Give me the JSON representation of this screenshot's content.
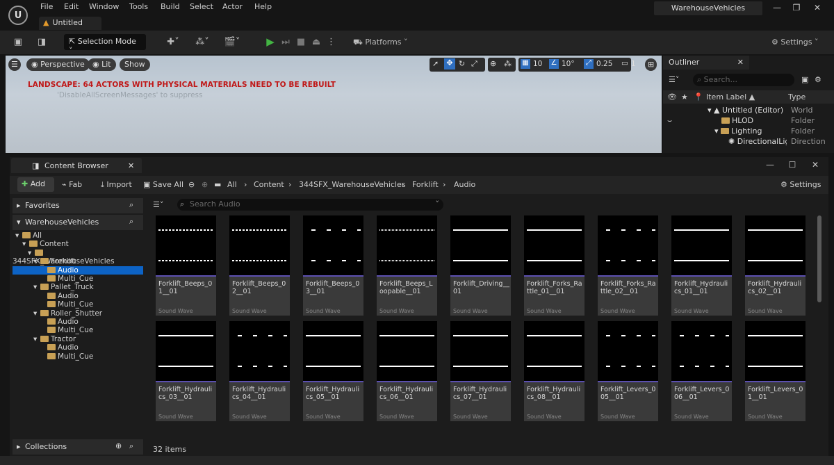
{
  "menubar": {
    "logo": "U",
    "items": [
      "File",
      "Edit",
      "Window",
      "Tools",
      "Build",
      "Select",
      "Actor",
      "Help"
    ],
    "level_tab": "Untitled",
    "project": "WarehouseVehicles"
  },
  "toolbar": {
    "selection_mode": "Selection Mode",
    "platforms": "Platforms",
    "settings": "Settings"
  },
  "viewport": {
    "perspective": "Perspective",
    "lit": "Lit",
    "show": "Show",
    "warning": "LANDSCAPE: 64 ACTORS WITH PHYSICAL MATERIALS NEED TO BE REBUILT",
    "warning_sub": "'DisableAllScreenMessages' to suppress",
    "grid": "10",
    "angle": "10°",
    "scale": "0.25",
    "camera": "1"
  },
  "outliner": {
    "title": "Outliner",
    "search_placeholder": "Search...",
    "col_label": "Item Label ▲",
    "col_type": "Type",
    "rows": [
      {
        "label": "Untitled (Editor)",
        "type": "World"
      },
      {
        "label": "HLOD",
        "type": "Folder"
      },
      {
        "label": "Lighting",
        "type": "Folder"
      },
      {
        "label": "DirectionalLigl",
        "type": "Direction"
      }
    ]
  },
  "content_browser": {
    "title": "Content Browser",
    "add": "Add",
    "fab": "Fab",
    "import": "Import",
    "save_all": "Save All",
    "settings": "Settings",
    "breadcrumb": [
      "All",
      "Content",
      "344SFX_WarehouseVehicles",
      "Forklift",
      "Audio"
    ],
    "favorites": "Favorites",
    "project": "WarehouseVehicles",
    "collections": "Collections",
    "search_placeholder": "Search Audio",
    "item_count": "32 items",
    "tree": [
      "All",
      "Content",
      "344SFX_WarehouseVehicles",
      "Forklift",
      "Audio",
      "Multi_Cue",
      "Pallet_Truck",
      "Audio",
      "Multi_Cue",
      "Roller_Shutter",
      "Audio",
      "Multi_Cue",
      "Tractor",
      "Audio",
      "Multi_Cue"
    ],
    "assets": [
      {
        "name": "Forklift_Beeps_01__01",
        "type": "Sound Wave"
      },
      {
        "name": "Forklift_Beeps_02__01",
        "type": "Sound Wave"
      },
      {
        "name": "Forklift_Beeps_03__01",
        "type": "Sound Wave"
      },
      {
        "name": "Forklift_Beeps_Loopable__01",
        "type": "Sound Wave"
      },
      {
        "name": "Forklift_Driving__01",
        "type": "Sound Wave"
      },
      {
        "name": "Forklift_Forks_Rattle_01__01",
        "type": "Sound Wave"
      },
      {
        "name": "Forklift_Forks_Rattle_02__01",
        "type": "Sound Wave"
      },
      {
        "name": "Forklift_Hydraulics_01__01",
        "type": "Sound Wave"
      },
      {
        "name": "Forklift_Hydraulics_02__01",
        "type": "Sound Wave"
      },
      {
        "name": "Forklift_Hydraulics_03__01",
        "type": "Sound Wave"
      },
      {
        "name": "Forklift_Hydraulics_04__01",
        "type": "Sound Wave"
      },
      {
        "name": "Forklift_Hydraulics_05__01",
        "type": "Sound Wave"
      },
      {
        "name": "Forklift_Hydraulics_06__01",
        "type": "Sound Wave"
      },
      {
        "name": "Forklift_Hydraulics_07__01",
        "type": "Sound Wave"
      },
      {
        "name": "Forklift_Hydraulics_08__01",
        "type": "Sound Wave"
      },
      {
        "name": "Forklift_Levers_005__01",
        "type": "Sound Wave"
      },
      {
        "name": "Forklift_Levers_006__01",
        "type": "Sound Wave"
      },
      {
        "name": "Forklift_Levers_01__01",
        "type": "Sound Wave"
      }
    ]
  },
  "colors": {
    "accent": "#0d63c5",
    "play": "#43b443",
    "warning": "#c01818",
    "folder": "#c8a055",
    "thumb_bar": "#5b4fb0"
  }
}
